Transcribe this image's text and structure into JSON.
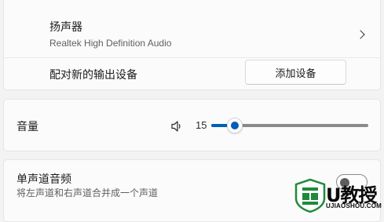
{
  "output": {
    "device_name": "扬声器",
    "device_description": "Realtek High Definition Audio",
    "pair_label": "配对新的输出设备",
    "add_device_button": "添加设备"
  },
  "volume": {
    "label": "音量",
    "value_text": "15",
    "level": 0.15,
    "accent_color": "#005fb8"
  },
  "mono": {
    "title": "单声道音频",
    "description": "将左声道和右声道合并成一个声道",
    "toggle_state": "off"
  },
  "watermark": {
    "brand": "U教授",
    "url": "UJIAOSHOU.COM"
  }
}
